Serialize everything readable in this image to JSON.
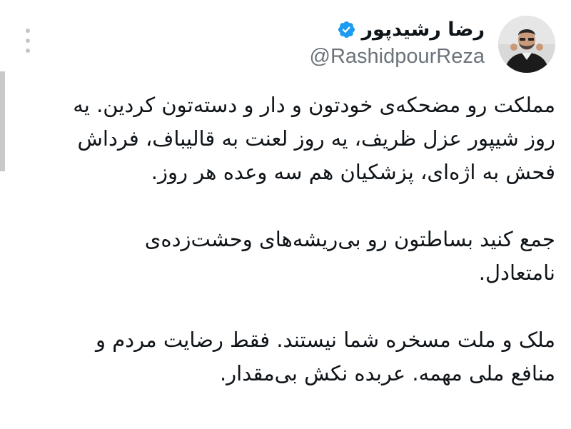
{
  "author": {
    "display_name": "رضا رشیدپور",
    "handle": "@RashidpourReza",
    "verified": true,
    "avatar": "profile-photo"
  },
  "tweet": {
    "paragraphs": [
      "مملکت رو مضحکه‌ی خودتون و دار و دسته‌تون کردین. یه روز شیپور عزل ظریف، یه روز لعنت به قالیباف، فرداش فحش به اژه‌ای، پزشکیان هم سه وعده هر روز.",
      "جمع کنید بساطتون رو بی‌ریشه‌های وحشت‌زده‌ی نامتعادل.",
      "ملک و ملت مسخره شما نیستند. فقط رضایت مردم و منافع ملی مهمه. عربده نکش بی‌مقدار."
    ]
  },
  "icons": {
    "more": "more-options-icon",
    "verified": "verified-badge-icon"
  },
  "colors": {
    "text": "#0f1419",
    "secondary_text": "#6b737b",
    "verified_blue": "#1d9bf0",
    "background": "#ffffff"
  }
}
